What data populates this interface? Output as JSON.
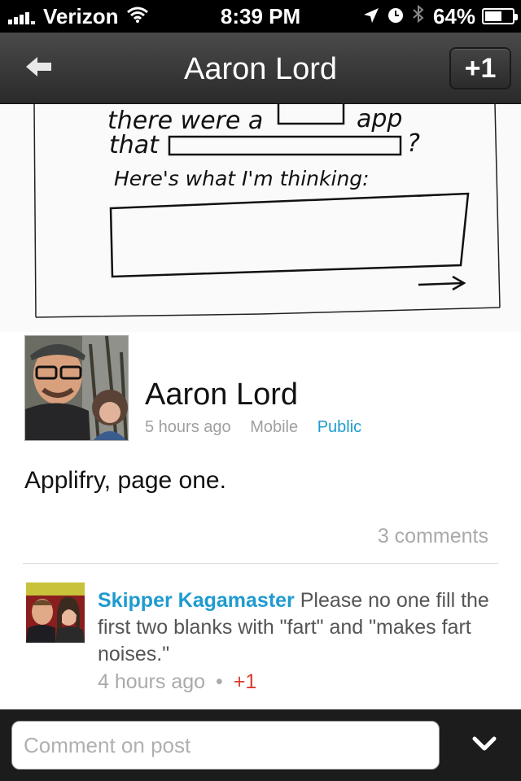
{
  "status_bar": {
    "carrier": "Verizon",
    "time": "8:39 PM",
    "battery": "64%",
    "battery_level": 0.64,
    "icons": [
      "signal-icon",
      "wifi-icon",
      "location-arrow-icon",
      "clock-icon",
      "bluetooth-icon",
      "battery-icon"
    ]
  },
  "nav": {
    "back_icon": "back-arrow-icon",
    "title": "Aaron Lord",
    "plus_one": "+1"
  },
  "sketch": {
    "line1_a": "there were a",
    "line1_b": "app",
    "line2": "that",
    "line2_q": "?",
    "line3": "Here's what I'm thinking:"
  },
  "post": {
    "author": "Aaron Lord",
    "time": "5 hours ago",
    "source": "Mobile",
    "visibility": "Public",
    "body": "Applifry, page one.",
    "comment_count": "3 comments"
  },
  "comment": {
    "author": "Skipper Kagamaster",
    "text": "Please no one fill the first two blanks with \"fart\" and \"makes fart noises.\"",
    "time": "4 hours ago",
    "separator": "•",
    "plus": "+1"
  },
  "composer": {
    "placeholder": "Comment on post",
    "collapse_icon": "chevron-down-icon"
  },
  "colors": {
    "link": "#1f9bcf",
    "plus_red": "#d93b2b",
    "nav_bg": "#333333"
  }
}
